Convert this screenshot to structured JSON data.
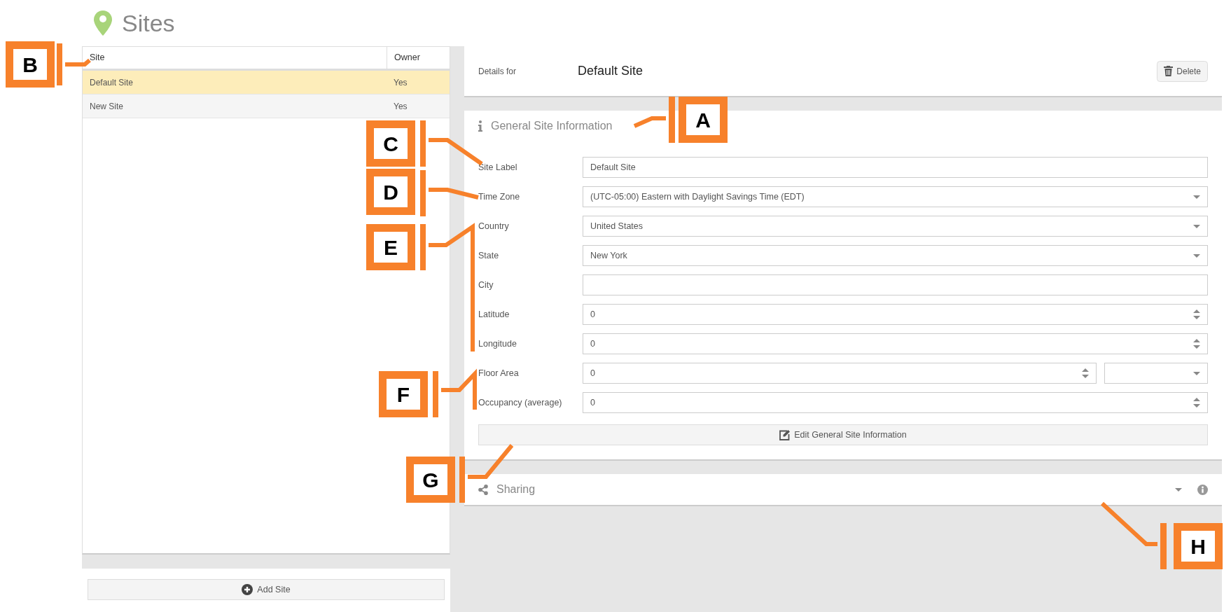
{
  "page": {
    "title": "Sites"
  },
  "sites_table": {
    "columns": [
      "Site",
      "Owner"
    ],
    "rows": [
      {
        "site": "Default Site",
        "owner": "Yes",
        "selected": true
      },
      {
        "site": "New Site",
        "owner": "Yes",
        "selected": false
      }
    ]
  },
  "add_button": "Add Site",
  "details": {
    "label": "Details for",
    "name": "Default Site",
    "delete_button": "Delete"
  },
  "general_section": {
    "title": "General Site Information",
    "fields": [
      {
        "label": "Site Label",
        "kind": "text",
        "value": "Default Site"
      },
      {
        "label": "Time Zone",
        "kind": "select",
        "value": "(UTC-05:00) Eastern with Daylight Savings Time (EDT)"
      },
      {
        "label": "Country",
        "kind": "select",
        "value": "United States"
      },
      {
        "label": "State",
        "kind": "select",
        "value": "New York"
      },
      {
        "label": "City",
        "kind": "text"
      },
      {
        "label": "Latitude",
        "kind": "number",
        "value": "0"
      },
      {
        "label": "Longitude",
        "kind": "number",
        "value": "0"
      },
      {
        "label": "Floor Area",
        "kind": "number_unit",
        "value": "0"
      },
      {
        "label": "Occupancy (average)",
        "kind": "number",
        "value": "0"
      }
    ],
    "edit_button": "Edit General Site Information"
  },
  "sharing_section": {
    "title": "Sharing"
  },
  "callouts": [
    {
      "letter": "B"
    },
    {
      "letter": "A"
    },
    {
      "letter": "C"
    },
    {
      "letter": "D"
    },
    {
      "letter": "E"
    },
    {
      "letter": "F"
    },
    {
      "letter": "G"
    },
    {
      "letter": "H"
    }
  ]
}
